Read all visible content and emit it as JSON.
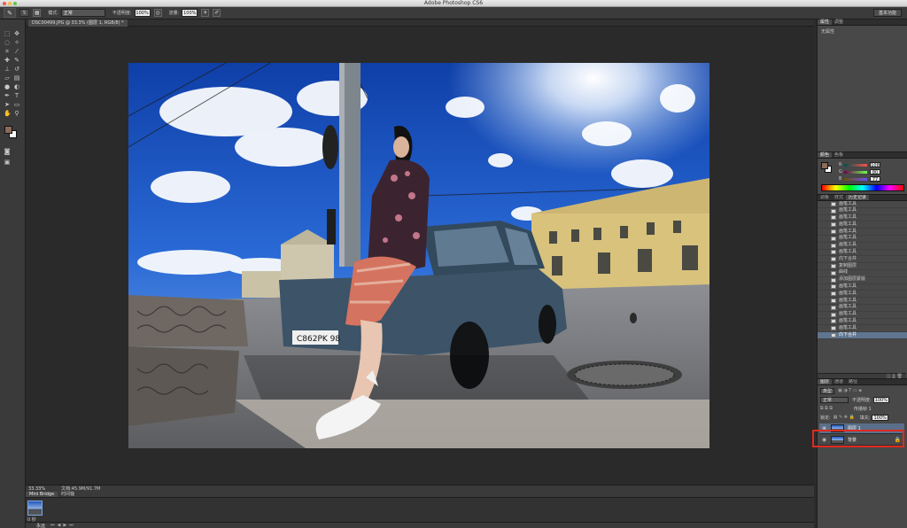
{
  "app": {
    "title": "Adobe Photoshop CS6"
  },
  "options_bar": {
    "mode_label": "模式:",
    "mode_value": "正常",
    "opacity_label": "不透明度:",
    "opacity_value": "100%",
    "flow_label": "流量:",
    "flow_value": "100%",
    "brush_size": "5",
    "workspace": "基本功能"
  },
  "document": {
    "tab_title": "DSC00499.JPG @ 33.3% (图层 1, RGB/8) *",
    "zoom": "33.33%",
    "doc_info": "文档:45.9M/91.7M",
    "plate_text": "C862PK 98"
  },
  "mini_bridge": {
    "tabs": [
      "Mini Bridge",
      "时间轴"
    ],
    "thumb_label": "0 秒",
    "foot_select": "永远"
  },
  "panels": {
    "props_tabs": [
      "属性",
      "调整"
    ],
    "props_empty": "无属性",
    "color_tabs": [
      "颜色",
      "色板"
    ],
    "color": {
      "r": "108",
      "g": "80",
      "b": "77",
      "r_label": "R",
      "g_label": "G",
      "b_label": "B"
    },
    "history_tabs": [
      "调板",
      "样式",
      "历史记录"
    ],
    "history_items": [
      "画笔工具",
      "画笔工具",
      "画笔工具",
      "画笔工具",
      "画笔工具",
      "画笔工具",
      "画笔工具",
      "画笔工具",
      "向下合并",
      "复制图层",
      "曲线",
      "添加图层蒙版",
      "画笔工具",
      "画笔工具",
      "画笔工具",
      "画笔工具",
      "画笔工具",
      "画笔工具",
      "画笔工具",
      "向下合并"
    ],
    "layers_tabs": [
      "图层",
      "通道",
      "路径"
    ],
    "layers_kind": "类型",
    "layers_blend": "正常",
    "layers_opacity_label": "不透明度:",
    "layers_opacity": "100%",
    "layers_lock_label": "锁定:",
    "layers_fill_label": "填充:",
    "layers_fill": "100%",
    "layers_propagate": "传播帧 1",
    "layers": [
      {
        "name": "图层 1",
        "active": true
      },
      {
        "name": "背景",
        "active": false
      }
    ]
  },
  "colors": {
    "foreground": "#8d6a5a",
    "background": "#ffffff",
    "highlight": "#e02a1f",
    "sky": "#1f57c4"
  }
}
